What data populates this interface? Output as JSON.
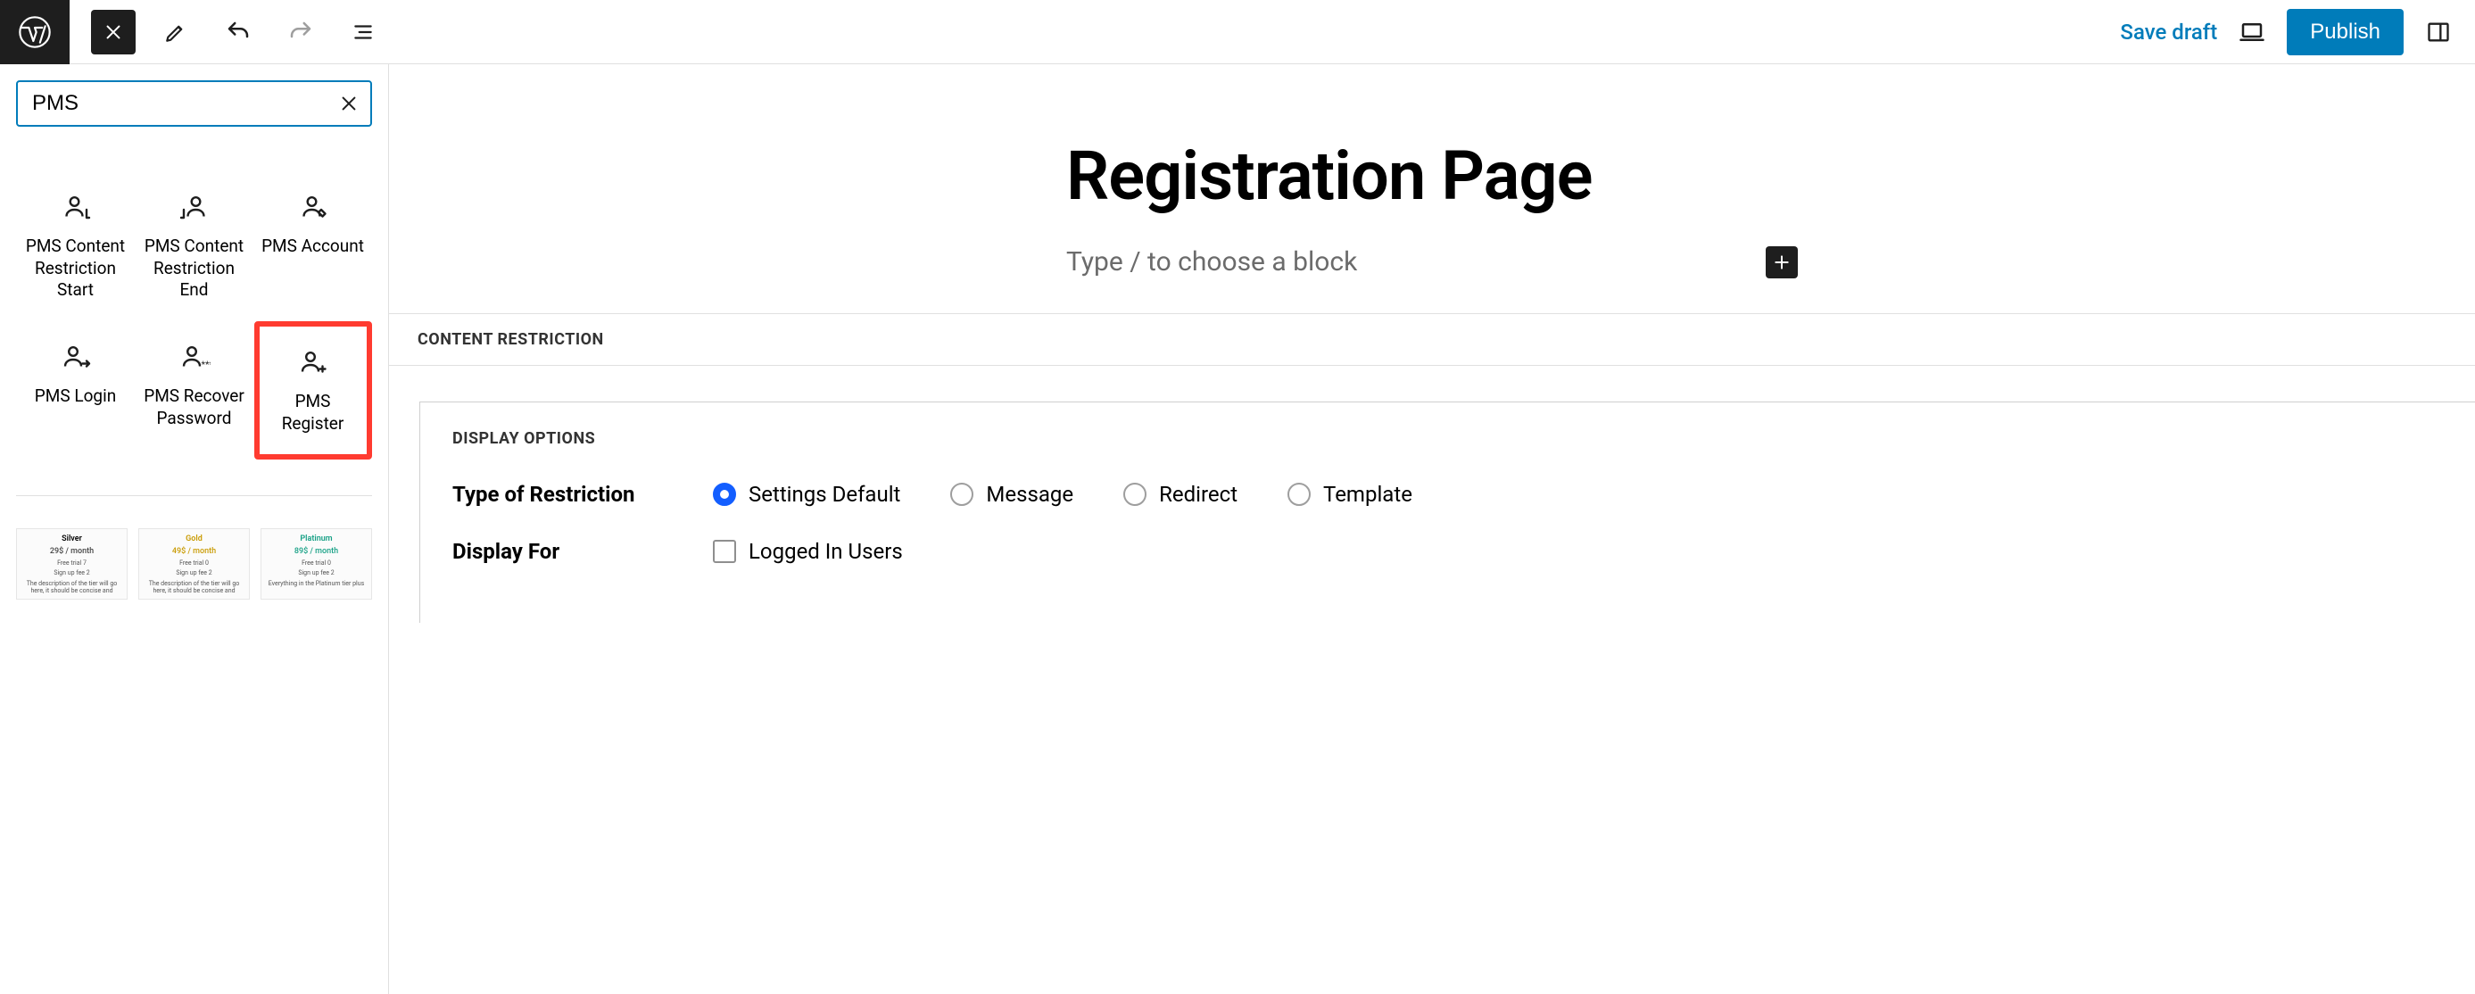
{
  "topbar": {
    "save_draft": "Save draft",
    "publish": "Publish"
  },
  "sidebar": {
    "search_value": "PMS",
    "blocks": [
      {
        "id": "pms-content-restriction-start",
        "label": "PMS Content Restriction Start"
      },
      {
        "id": "pms-content-restriction-end",
        "label": "PMS Content Restriction End"
      },
      {
        "id": "pms-account",
        "label": "PMS Account"
      },
      {
        "id": "pms-login",
        "label": "PMS Login"
      },
      {
        "id": "pms-recover-password",
        "label": "PMS Recover Password"
      },
      {
        "id": "pms-register",
        "label": "PMS Register"
      }
    ],
    "preview_tiers": [
      {
        "name": "Silver",
        "price": "29$ / month"
      },
      {
        "name": "Gold",
        "price": "49$ / month"
      },
      {
        "name": "Platinum",
        "price": "89$ / month"
      }
    ]
  },
  "page": {
    "title": "Registration Page",
    "placeholder": "Type / to choose a block"
  },
  "cr": {
    "band": "CONTENT RESTRICTION",
    "section": "DISPLAY OPTIONS",
    "row1_label": "Type of Restriction",
    "row2_label": "Display For",
    "radios": [
      "Settings Default",
      "Message",
      "Redirect",
      "Template"
    ],
    "radio_selected": 0,
    "check_label": "Logged In Users"
  }
}
